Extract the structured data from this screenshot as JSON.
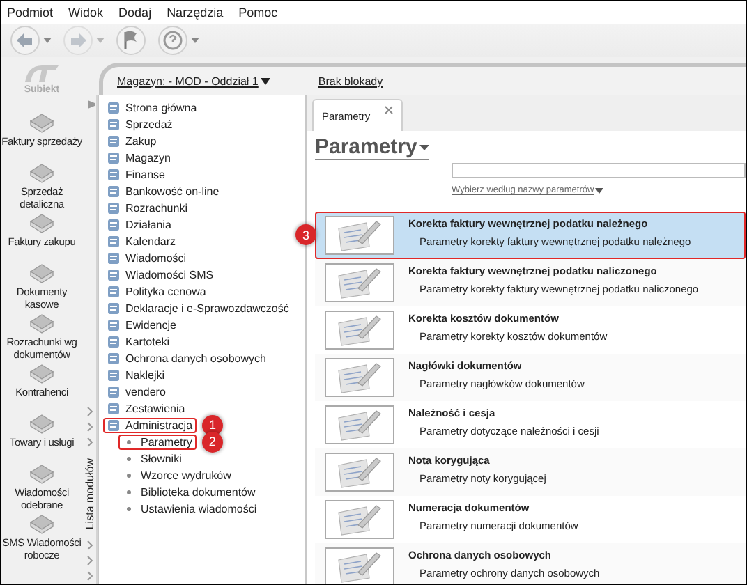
{
  "menu": [
    "Podmiot",
    "Widok",
    "Dodaj",
    "Narzędzia",
    "Pomoc"
  ],
  "toolbar": [
    {
      "kind": "back",
      "disabled": false,
      "dropdown": true
    },
    {
      "kind": "forward",
      "disabled": true,
      "dropdown": true
    },
    {
      "kind": "flag",
      "disabled": false,
      "dropdown": false
    },
    {
      "kind": "help",
      "disabled": false,
      "dropdown": true
    }
  ],
  "sidebar": {
    "logo": "Subiekt",
    "items": [
      "Faktury sprzedaży",
      "Sprzedaż detaliczna",
      "Faktury zakupu",
      "Dokumenty kasowe",
      "Rozrachunki wg dokumentów",
      "Kontrahenci",
      "Towary i usługi",
      "Wiadomości odebrane",
      "SMS Wiadomości robocze"
    ]
  },
  "location_bar": {
    "warehouse": "Magazyn: - MOD - Oddział 1",
    "lock_status": "Brak blokady"
  },
  "rail": {
    "label": "Lista modułów"
  },
  "tree": {
    "items": [
      {
        "label": "Strona główna",
        "annotated": false
      },
      {
        "label": "Sprzedaż",
        "annotated": false
      },
      {
        "label": "Zakup",
        "annotated": false
      },
      {
        "label": "Magazyn",
        "annotated": false
      },
      {
        "label": "Finanse",
        "annotated": false
      },
      {
        "label": "Bankowość on-line",
        "annotated": false
      },
      {
        "label": "Rozrachunki",
        "annotated": false
      },
      {
        "label": "Działania",
        "annotated": false
      },
      {
        "label": "Kalendarz",
        "annotated": false
      },
      {
        "label": "Wiadomości",
        "annotated": false
      },
      {
        "label": "Wiadomości SMS",
        "annotated": false
      },
      {
        "label": "Polityka cenowa",
        "annotated": false
      },
      {
        "label": "Deklaracje i e-Sprawozdawczość",
        "annotated": false
      },
      {
        "label": "Ewidencje",
        "annotated": false
      },
      {
        "label": "Kartoteki",
        "annotated": false
      },
      {
        "label": "Ochrona danych osobowych",
        "annotated": false
      },
      {
        "label": "Naklejki",
        "annotated": false
      },
      {
        "label": "vendero",
        "annotated": false
      },
      {
        "label": "Zestawienia",
        "annotated": false
      },
      {
        "label": "Administracja",
        "annotated": true,
        "marker": "1",
        "children": [
          {
            "label": "Parametry",
            "annotated": true,
            "marker": "2"
          },
          {
            "label": "Słowniki",
            "annotated": false
          },
          {
            "label": "Wzorce wydruków",
            "annotated": false
          },
          {
            "label": "Biblioteka dokumentów",
            "annotated": false
          },
          {
            "label": "Ustawienia wiadomości",
            "annotated": false
          }
        ]
      }
    ]
  },
  "tabs": [
    {
      "label": "Parametry",
      "selected": true
    }
  ],
  "page_title": "Parametry",
  "filter_link": "Wybierz według nazwy parametrów",
  "rows": [
    {
      "title": "Korekta faktury wewnętrznej podatku należnego",
      "description": "Parametry korekty faktury wewnętrznej podatku należnego",
      "selected": true,
      "marker": "3"
    },
    {
      "title": "Korekta faktury wewnętrznej podatku naliczonego",
      "description": "Parametry korekty faktury wewnętrznej podatku naliczonego",
      "selected": false
    },
    {
      "title": "Korekta kosztów dokumentów",
      "description": "Parametry korekty kosztów dokumentów",
      "selected": false
    },
    {
      "title": "Nagłówki dokumentów",
      "description": "Parametry nagłówków dokumentów",
      "selected": false
    },
    {
      "title": "Należność i cesja",
      "description": "Parametry dotyczące należności i cesji",
      "selected": false
    },
    {
      "title": "Nota korygująca",
      "description": "Parametry noty korygującej",
      "selected": false
    },
    {
      "title": "Numeracja dokumentów",
      "description": "Parametry numeracji dokumentów",
      "selected": false
    },
    {
      "title": "Ochrona danych osobowych",
      "description": "Parametry ochrony danych osobowych",
      "selected": false
    }
  ]
}
